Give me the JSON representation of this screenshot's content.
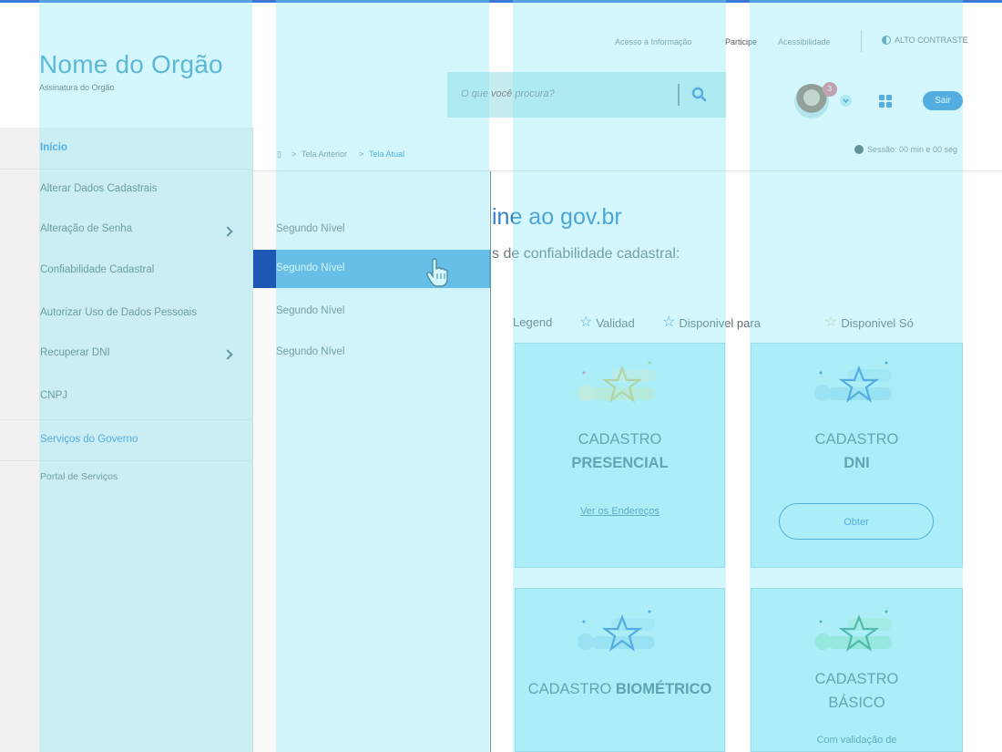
{
  "header": {
    "org_name": "Nome do Orgão",
    "org_subtitle": "Assinatura do Orgão",
    "links": [
      "Acesso à Informação",
      "Participe",
      "Acessibilidade"
    ],
    "contrast_label": "ALTO CONTRASTE",
    "search_placeholder": "O que você procura?",
    "notification_count": "3",
    "logout_label": "Sair"
  },
  "breadcrumb": {
    "home_icon": "home-icon",
    "separator": ">",
    "items": [
      "Tela Anterior",
      "Tela Atual"
    ]
  },
  "session_text": "Sessão: 00 min e 00 seg",
  "menu": {
    "items": [
      "Início",
      "Alterar Dados Cadastrais",
      "Alteração de Senha",
      "Confiabilidade Cadastral",
      "Autorizar Uso de Dados Pessoais",
      "Recuperar DNI",
      "CNPJ",
      "Serviços do Governo",
      "Portal de Serviços"
    ],
    "submenu": [
      "Segundo Nível",
      "Segundo Nível",
      "Segundo Nível",
      "Segundo Nível"
    ]
  },
  "main": {
    "title": "ine ao gov.br",
    "subtitle": "s de confiabilidade cadastral:",
    "legend": [
      "Legend",
      "Validad",
      "Disponivel para",
      "Disponivel Só"
    ]
  },
  "cards": [
    {
      "title_line1": "CADASTRO",
      "title_line2": "PRESENCIAL",
      "link": "Ver os Endereços"
    },
    {
      "title_line1": "CADASTRO",
      "title_line2": "DNI",
      "button": "Obter"
    },
    {
      "title_a": "CADASTRO ",
      "title_b": "BIOMÉTRICO"
    },
    {
      "title_line1": "CADASTRO",
      "title_line2": "BÁSICO",
      "note": "Com validação de"
    }
  ],
  "colors": {
    "primary": "#3c8ed6",
    "dark_accent": "#1f57b5",
    "overlay": "#82e9f5"
  }
}
